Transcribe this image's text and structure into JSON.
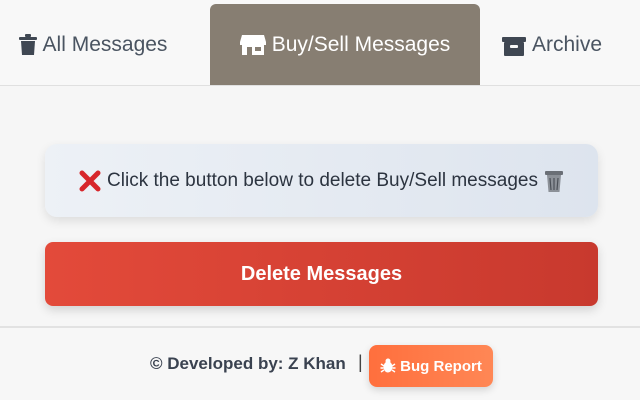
{
  "tabs": [
    {
      "label": "All Messages",
      "icon": "trash-icon",
      "active": false
    },
    {
      "label": "Buy/Sell Messages",
      "icon": "store-icon",
      "active": true
    },
    {
      "label": "Archive",
      "icon": "archive-box-icon",
      "active": false
    }
  ],
  "info": {
    "text": "Click the button below to delete Buy/Sell messages",
    "leading_icon": "red-x-icon",
    "trailing_icon": "wastebasket-icon"
  },
  "actions": {
    "delete_label": "Delete Messages"
  },
  "footer": {
    "developer_text": "© Developed by: Z Khan",
    "separator": "|",
    "bug_report_label": "Bug Report",
    "bug_icon": "bug-icon"
  },
  "colors": {
    "active_tab": "#877e72",
    "delete_button": "#d8412f",
    "bug_button": "#ff7a48"
  }
}
